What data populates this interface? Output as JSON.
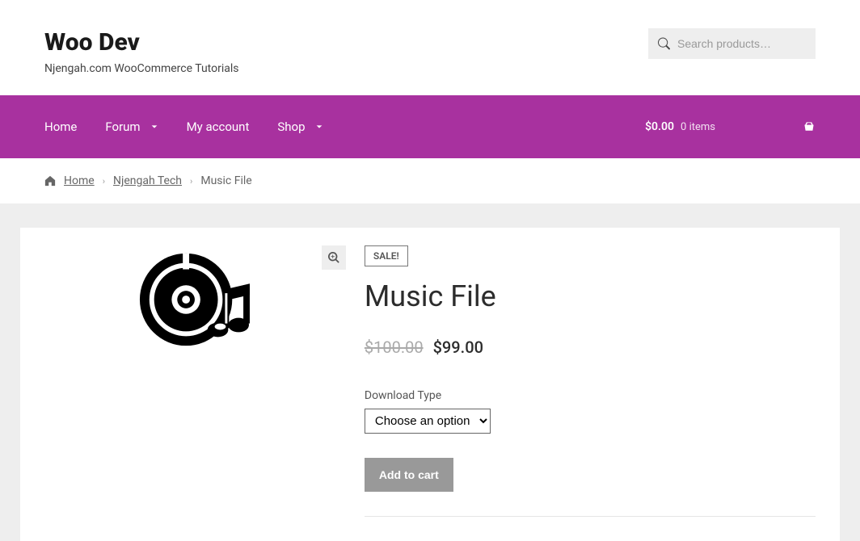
{
  "site": {
    "title": "Woo Dev",
    "tagline": "Njengah.com WooCommerce Tutorials"
  },
  "search": {
    "placeholder": "Search products…"
  },
  "nav": {
    "items": [
      {
        "label": "Home",
        "has_dropdown": false
      },
      {
        "label": "Forum",
        "has_dropdown": true
      },
      {
        "label": "My account",
        "has_dropdown": false
      },
      {
        "label": "Shop",
        "has_dropdown": true
      }
    ]
  },
  "cart": {
    "total": "$0.00",
    "items_text": "0 items"
  },
  "breadcrumb": {
    "home": "Home",
    "category": "Njengah Tech",
    "current": "Music File"
  },
  "product": {
    "sale_badge": "SALE!",
    "title": "Music File",
    "old_price": "$100.00",
    "new_price": "$99.00",
    "variation_label": "Download Type",
    "variation_placeholder": "Choose an option",
    "add_to_cart": "Add to cart"
  }
}
